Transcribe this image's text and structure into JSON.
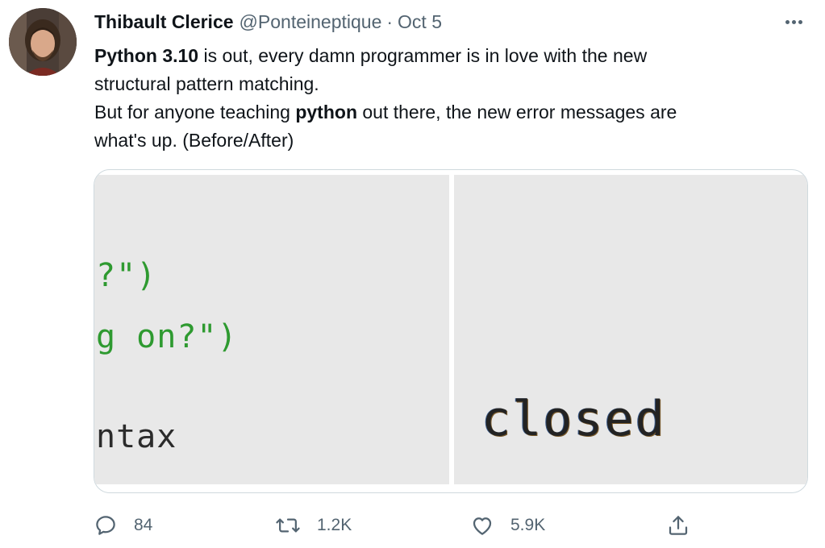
{
  "tweet": {
    "author_name": "Thibault Clerice",
    "author_handle": "@Ponteineptique",
    "separator": "·",
    "date": "Oct 5",
    "text_lines": [
      {
        "bold": "Python 3.10",
        "rest": " is out, every damn programmer is in love with the new"
      },
      {
        "text": "structural pattern matching."
      },
      {
        "pre": "But for anyone teaching ",
        "bold": "python",
        "post": " out there, the new error messages are"
      },
      {
        "text": "what's up. (Before/After)"
      }
    ],
    "more_icon": "more-horizontal-icon"
  },
  "media": {
    "before_lines": [
      "?\")",
      "g on?\")",
      "ntax"
    ],
    "after_lines": [
      "closed"
    ]
  },
  "actions": {
    "reply_count": "84",
    "retweet_count": "1.2K",
    "like_count": "5.9K",
    "icons": [
      "reply-icon",
      "retweet-icon",
      "like-icon",
      "share-icon"
    ]
  },
  "colors": {
    "text": "#0f1419",
    "secondary": "#536471",
    "code_green": "#2e9a30",
    "border": "#cfd9de"
  }
}
